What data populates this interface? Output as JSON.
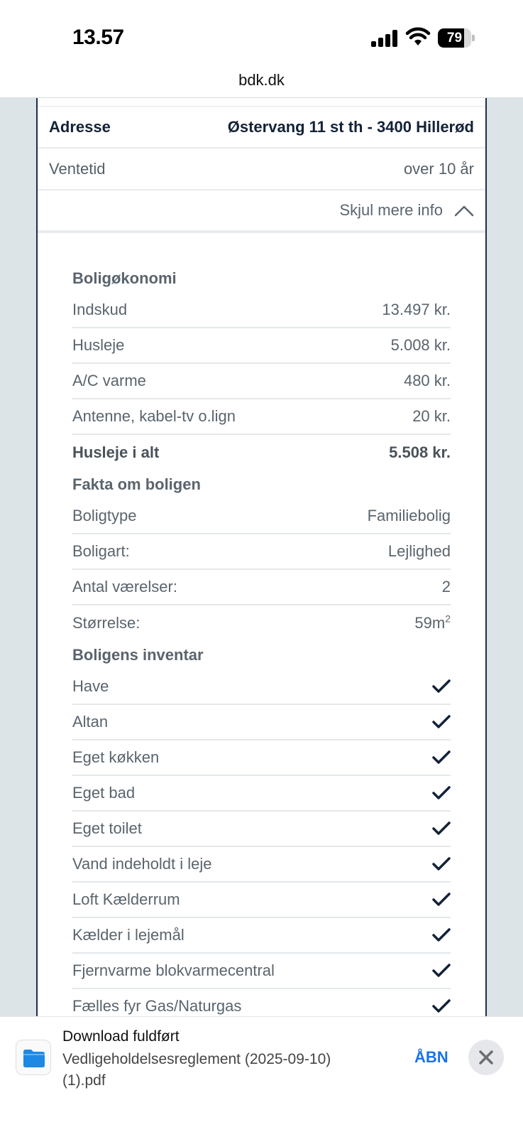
{
  "status_bar": {
    "time": "13.57",
    "battery": "79",
    "battery_level": 0.79
  },
  "browser": {
    "url": "bdk.dk"
  },
  "listing": {
    "address_label": "Adresse",
    "address_value": "Østervang 11 st th - 3400 Hillerød",
    "wait_label": "Ventetid",
    "wait_value": "over 10 år",
    "toggle_label": "Skjul mere info"
  },
  "economy": {
    "title": "Boligøkonomi",
    "rows": [
      {
        "label": "Indskud",
        "value": "13.497 kr."
      },
      {
        "label": "Husleje",
        "value": "5.008 kr."
      },
      {
        "label": "A/C varme",
        "value": "480 kr."
      },
      {
        "label": "Antenne, kabel-tv o.lign",
        "value": "20 kr."
      }
    ],
    "total_label": "Husleje i alt",
    "total_value": "5.508 kr."
  },
  "facts": {
    "title": "Fakta om boligen",
    "rows": [
      {
        "label": "Boligtype",
        "value": "Familiebolig"
      },
      {
        "label": "Boligart:",
        "value": "Lejlighed"
      },
      {
        "label": "Antal værelser:",
        "value": "2"
      }
    ],
    "size_label": "Størrelse:",
    "size_value": "59m",
    "size_sup": "2"
  },
  "inventory": {
    "title": "Boligens inventar",
    "items": [
      "Have",
      "Altan",
      "Eget køkken",
      "Eget bad",
      "Eget toilet",
      "Vand indeholdt i leje",
      "Loft Kælderrum",
      "Kælder i lejemål",
      "Fjernvarme blokvarmecentral",
      "Fælles fyr Gas/Naturgas"
    ]
  },
  "download": {
    "title": "Download fuldført",
    "filename_line1": "Vedligeholdelsesreglement (2025-09-10)",
    "filename_line2": "(1).pdf",
    "open_label": "ÅBN"
  },
  "colors": {
    "accent": "#1a73e8",
    "navy": "#132238",
    "page_bg": "#dce4e8"
  }
}
